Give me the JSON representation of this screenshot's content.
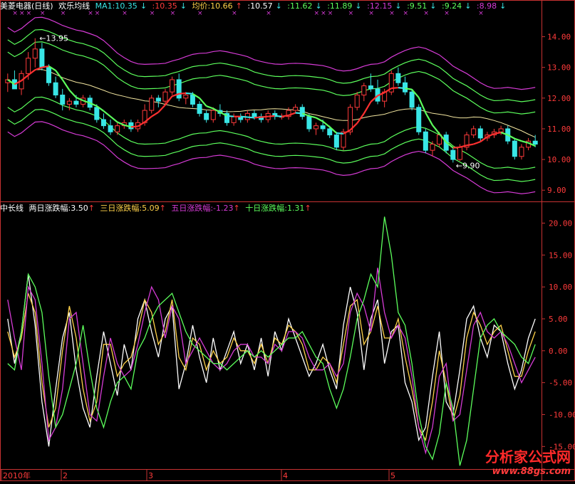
{
  "colors": {
    "up": "#ff3b3b",
    "down": "#39e6e6",
    "white": "#ffffff",
    "yellow": "#ffd24a",
    "magenta": "#d63bd6",
    "green": "#5cff5c",
    "axis": "#c83232",
    "label": "#ff4040",
    "gridText": "#ff3b3b"
  },
  "top_header": {
    "title": "美菱电器(日线)",
    "indicator": "欢乐均线",
    "ma1_label": "MA1:10.35",
    "v2": ":10.35",
    "avg_label": "均价:10.66",
    "v4": ":10.57",
    "v5": ":11.62",
    "v6": ":11.89",
    "v7": ":12.15",
    "v8": ":9.51",
    "v9": ":9.24",
    "v10": ":8.98"
  },
  "bottom_header": {
    "name": "中长线",
    "s1": "两日涨跌幅:3.50",
    "s2": "三日涨跌幅:5.09",
    "s3": "五日涨跌幅:-1.23",
    "s4": "十日涨跌幅:1.31"
  },
  "annotations": {
    "high": "13.95",
    "low": "9.90"
  },
  "x_labels": [
    "2010年",
    "2",
    "3",
    "4",
    "5"
  ],
  "watermark": {
    "line1": "分析家公式网",
    "line2": "www.88gs.com"
  },
  "chart_data": [
    {
      "type": "candlestick",
      "title": "美菱电器(日线) 欢乐均线",
      "ylim": [
        8.75,
        14.5
      ],
      "yticks": [
        9.0,
        10.0,
        11.0,
        12.0,
        13.0,
        14.0
      ],
      "candles": [
        [
          12.5,
          12.8,
          12.2,
          12.6
        ],
        [
          12.6,
          12.9,
          12.4,
          12.3
        ],
        [
          12.3,
          12.9,
          12.1,
          12.8
        ],
        [
          12.8,
          13.5,
          12.6,
          13.3
        ],
        [
          13.3,
          13.95,
          13.0,
          13.6
        ],
        [
          13.6,
          13.8,
          12.9,
          13.0
        ],
        [
          13.0,
          13.1,
          12.4,
          12.5
        ],
        [
          12.5,
          12.7,
          12.0,
          12.1
        ],
        [
          12.1,
          12.3,
          11.6,
          11.8
        ],
        [
          11.8,
          12.0,
          11.6,
          11.9
        ],
        [
          11.9,
          12.1,
          11.7,
          11.8
        ],
        [
          11.8,
          12.1,
          11.7,
          12.0
        ],
        [
          12.0,
          12.1,
          11.6,
          11.7
        ],
        [
          11.7,
          11.8,
          11.2,
          11.3
        ],
        [
          11.3,
          11.5,
          11.0,
          11.1
        ],
        [
          11.1,
          11.3,
          10.8,
          10.9
        ],
        [
          10.9,
          11.2,
          10.8,
          11.1
        ],
        [
          11.1,
          11.3,
          11.0,
          11.2
        ],
        [
          11.2,
          11.3,
          10.9,
          11.0
        ],
        [
          11.0,
          11.3,
          10.9,
          11.2
        ],
        [
          11.2,
          11.8,
          11.1,
          11.6
        ],
        [
          11.6,
          12.1,
          11.5,
          12.0
        ],
        [
          12.0,
          12.1,
          11.7,
          11.9
        ],
        [
          11.9,
          12.3,
          11.8,
          12.2
        ],
        [
          12.2,
          12.7,
          12.1,
          12.6
        ],
        [
          12.6,
          12.8,
          11.9,
          12.0
        ],
        [
          12.0,
          12.2,
          11.8,
          12.1
        ],
        [
          12.1,
          12.2,
          11.7,
          11.8
        ],
        [
          11.8,
          11.9,
          11.4,
          11.5
        ],
        [
          11.5,
          11.6,
          11.2,
          11.3
        ],
        [
          11.3,
          11.7,
          11.2,
          11.6
        ],
        [
          11.6,
          11.8,
          11.4,
          11.5
        ],
        [
          11.5,
          11.6,
          11.1,
          11.2
        ],
        [
          11.2,
          11.5,
          11.1,
          11.4
        ],
        [
          11.4,
          11.5,
          11.2,
          11.3
        ],
        [
          11.3,
          11.6,
          11.2,
          11.5
        ],
        [
          11.5,
          11.6,
          11.3,
          11.4
        ],
        [
          11.4,
          11.5,
          11.2,
          11.3
        ],
        [
          11.3,
          11.6,
          11.2,
          11.5
        ],
        [
          11.5,
          11.6,
          11.3,
          11.4
        ],
        [
          11.4,
          11.5,
          11.3,
          11.4
        ],
        [
          11.4,
          11.7,
          11.3,
          11.6
        ],
        [
          11.6,
          11.8,
          11.5,
          11.7
        ],
        [
          11.7,
          11.8,
          11.3,
          11.4
        ],
        [
          11.4,
          11.5,
          10.9,
          11.0
        ],
        [
          11.0,
          11.2,
          10.8,
          11.1
        ],
        [
          11.1,
          11.3,
          10.9,
          11.0
        ],
        [
          11.0,
          11.1,
          10.7,
          10.8
        ],
        [
          10.8,
          10.9,
          10.3,
          10.4
        ],
        [
          10.4,
          11.0,
          10.3,
          10.9
        ],
        [
          10.9,
          11.8,
          10.8,
          11.7
        ],
        [
          11.7,
          12.2,
          11.6,
          12.1
        ],
        [
          12.1,
          12.5,
          11.9,
          12.4
        ],
        [
          12.4,
          12.8,
          12.2,
          12.3
        ],
        [
          12.3,
          12.6,
          11.8,
          11.9
        ],
        [
          11.9,
          12.3,
          11.7,
          12.2
        ],
        [
          12.2,
          12.9,
          12.1,
          12.8
        ],
        [
          12.8,
          13.0,
          12.4,
          12.5
        ],
        [
          12.5,
          12.7,
          12.1,
          12.2
        ],
        [
          12.2,
          12.3,
          11.6,
          11.7
        ],
        [
          11.7,
          11.8,
          10.8,
          10.9
        ],
        [
          10.9,
          11.0,
          10.2,
          10.3
        ],
        [
          10.3,
          10.6,
          10.1,
          10.5
        ],
        [
          10.5,
          10.9,
          10.4,
          10.8
        ],
        [
          10.8,
          10.9,
          10.2,
          10.3
        ],
        [
          10.3,
          10.4,
          9.9,
          10.0
        ],
        [
          10.0,
          10.5,
          9.95,
          10.4
        ],
        [
          10.4,
          10.9,
          10.3,
          10.8
        ],
        [
          10.8,
          11.1,
          10.7,
          11.0
        ],
        [
          11.0,
          11.1,
          10.6,
          10.7
        ],
        [
          10.7,
          10.9,
          10.6,
          10.8
        ],
        [
          10.8,
          11.0,
          10.7,
          10.9
        ],
        [
          10.9,
          11.1,
          10.8,
          11.0
        ],
        [
          11.0,
          11.1,
          10.5,
          10.6
        ],
        [
          10.6,
          10.7,
          10.0,
          10.1
        ],
        [
          10.1,
          10.5,
          10.0,
          10.4
        ],
        [
          10.4,
          10.7,
          10.3,
          10.6
        ],
        [
          10.6,
          10.8,
          10.4,
          10.5
        ]
      ],
      "bands": {
        "offsets": [
          0.9,
          1.3,
          1.7
        ],
        "names": []
      }
    },
    {
      "type": "line",
      "title": "中长线",
      "ylim": [
        -18.2,
        21.5
      ],
      "yticks": [
        -15.0,
        -10.0,
        -5.0,
        0.0,
        5.0,
        10.0,
        15.0,
        20.0
      ],
      "series": [
        {
          "name": "两日涨跌幅",
          "color": "white",
          "values": [
            5,
            -2,
            3,
            12,
            4,
            -8,
            -15,
            -6,
            2,
            6,
            -3,
            -9,
            -12,
            -4,
            3,
            -2,
            -7,
            1,
            -3,
            5,
            8,
            3,
            -1,
            5,
            7,
            -6,
            -2,
            4,
            -1,
            -5,
            2,
            -3,
            0,
            3,
            -2,
            1,
            -3,
            2,
            -4,
            3,
            0,
            5,
            2,
            -1,
            -4,
            -2,
            1,
            -3,
            -6,
            4,
            10,
            6,
            -3,
            5,
            8,
            -2,
            3,
            4,
            -5,
            -8,
            -14,
            -12,
            -4,
            3,
            -8,
            -10,
            -3,
            5,
            7,
            2,
            -1,
            4,
            3,
            -2,
            -6,
            -3,
            2,
            5
          ]
        },
        {
          "name": "三日涨跌幅",
          "color": "yellow",
          "values": [
            3,
            -1,
            2,
            9,
            6,
            -5,
            -12,
            -9,
            0,
            7,
            2,
            -6,
            -11,
            -8,
            1,
            1,
            -4,
            -2,
            -1,
            3,
            8,
            6,
            1,
            3,
            8,
            -1,
            -3,
            2,
            1,
            -3,
            0,
            -2,
            -1,
            2,
            0,
            0,
            -2,
            1,
            -2,
            2,
            1,
            4,
            3,
            1,
            -3,
            -3,
            -1,
            -2,
            -5,
            1,
            7,
            8,
            1,
            3,
            7,
            2,
            2,
            5,
            -1,
            -6,
            -12,
            -14,
            -8,
            0,
            -5,
            -11,
            -7,
            2,
            6,
            4,
            1,
            3,
            4,
            0,
            -4,
            -4,
            0,
            3
          ]
        },
        {
          "name": "五日涨跌幅",
          "color": "magenta",
          "values": [
            8,
            2,
            -3,
            10,
            8,
            -2,
            -14,
            -12,
            -6,
            5,
            6,
            -2,
            -10,
            -11,
            -4,
            2,
            -2,
            -4,
            -3,
            1,
            6,
            10,
            8,
            2,
            7,
            5,
            -2,
            0,
            2,
            0,
            -2,
            -3,
            -2,
            0,
            1,
            1,
            -1,
            -1,
            -2,
            1,
            0,
            3,
            3,
            2,
            -1,
            -3,
            -3,
            -2,
            -4,
            -2,
            6,
            9,
            7,
            3,
            13,
            6,
            2,
            4,
            2,
            -4,
            -12,
            -16,
            -12,
            -4,
            -2,
            -11,
            -10,
            -3,
            4,
            6,
            3,
            2,
            3,
            1,
            -2,
            -5,
            -3,
            -1
          ]
        },
        {
          "name": "十日涨跌幅",
          "color": "green",
          "values": [
            -2,
            -3,
            3,
            12,
            10,
            6,
            -4,
            -12,
            -10,
            -6,
            -2,
            4,
            -3,
            -9,
            -12,
            -8,
            -5,
            -4,
            -6,
            0,
            2,
            5,
            7,
            8,
            9,
            6,
            3,
            1,
            0,
            -1,
            -2,
            -2,
            -3,
            -2,
            -1,
            0,
            -1,
            0,
            -1,
            0,
            1,
            2,
            2,
            3,
            1,
            -1,
            -2,
            -6,
            -9,
            -6,
            -1,
            5,
            8,
            12,
            10,
            21,
            15,
            6,
            4,
            -2,
            -10,
            -15,
            -17,
            -13,
            -5,
            -9,
            -18,
            -14,
            -6,
            2,
            4,
            5,
            3,
            2,
            1,
            -1,
            -2,
            1
          ]
        }
      ]
    }
  ]
}
